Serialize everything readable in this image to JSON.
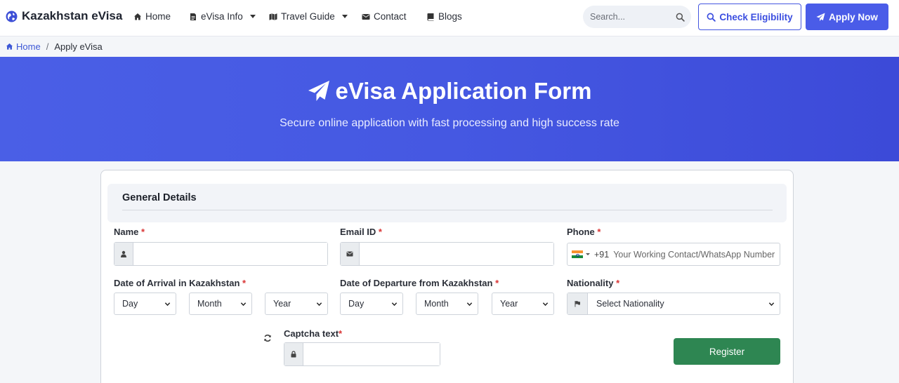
{
  "navbar": {
    "brand": "Kazakhstan eVisa",
    "links": [
      {
        "label": "Home",
        "icon": "home-icon"
      },
      {
        "label": "eVisa Info",
        "icon": "document-icon",
        "dropdown": true
      },
      {
        "label": "Travel Guide",
        "icon": "map-icon",
        "dropdown": true
      },
      {
        "label": "Contact",
        "icon": "envelope-icon"
      },
      {
        "label": "Blogs",
        "icon": "book-icon"
      }
    ],
    "search_placeholder": "Search...",
    "check_eligibility": "Check Eligibility",
    "apply_now": "Apply Now"
  },
  "breadcrumb": {
    "home": "Home",
    "separator": "/",
    "current": "Apply eVisa"
  },
  "hero": {
    "title": "eVisa Application Form",
    "subtitle": "Secure online application with fast processing and high success rate"
  },
  "form": {
    "section_title": "General Details",
    "required_mark": "*",
    "name_label": "Name",
    "email_label": "Email ID",
    "phone_label": "Phone",
    "phone_dial_code": "+91",
    "phone_placeholder": "Your Working Contact/WhatsApp Number",
    "arrival_label": "Date of Arrival in Kazakhstan",
    "departure_label": "Date of Departure from Kazakhstan",
    "nationality_label": "Nationality",
    "day": "Day",
    "month": "Month",
    "year": "Year",
    "nationality_placeholder": "Select Nationality",
    "captcha_label": "Captcha text",
    "register": "Register"
  },
  "colors": {
    "primary": "#4a5ce8",
    "hero_start": "#4a5fe6",
    "hero_end": "#3c4ad8",
    "success": "#2e8652",
    "required": "#d93535"
  }
}
